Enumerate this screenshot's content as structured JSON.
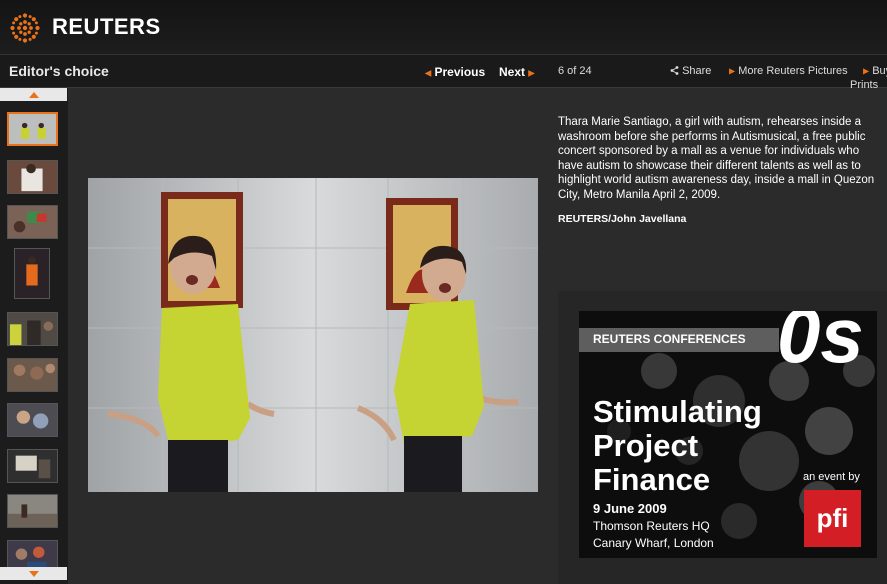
{
  "header": {
    "brand": "REUTERS",
    "logo_icon": "reuters-dot-logo-icon"
  },
  "toolbar": {
    "section_title": "Editor's choice",
    "previous_label": "Previous",
    "next_label": "Next",
    "counter": "6 of 24",
    "share_label": "Share",
    "more_pictures_label": "More Reuters Pictures",
    "buy_prints_label_1": "Buy",
    "buy_prints_label_2": "Prints"
  },
  "colors": {
    "accent": "#e8731a",
    "background": "#2b2b2b",
    "toolbar": "#1a1a1a",
    "pfi_red": "#d41e25"
  },
  "photo": {
    "caption": "Thara Marie Santiago, a girl with autism, rehearses inside a washroom before she performs in Autismusical, a free public concert sponsored by a mall as a venue for individuals who have autism to showcase their different talents as well as to highlight world autism awareness day, inside a mall in Quezon City, Metro Manila April 2, 2009.",
    "credit": "REUTERS/John Javellana"
  },
  "ad": {
    "brand": "REUTERS CONFERENCES",
    "corner_text": "0s",
    "title_1": "Stimulating",
    "title_2": "Project",
    "title_3": "Finance",
    "date": "9 June 2009",
    "location_1": "Thomson Reuters HQ",
    "location_2": "Canary Wharf, London",
    "event_by": "an event by",
    "sponsor": "pfi"
  }
}
